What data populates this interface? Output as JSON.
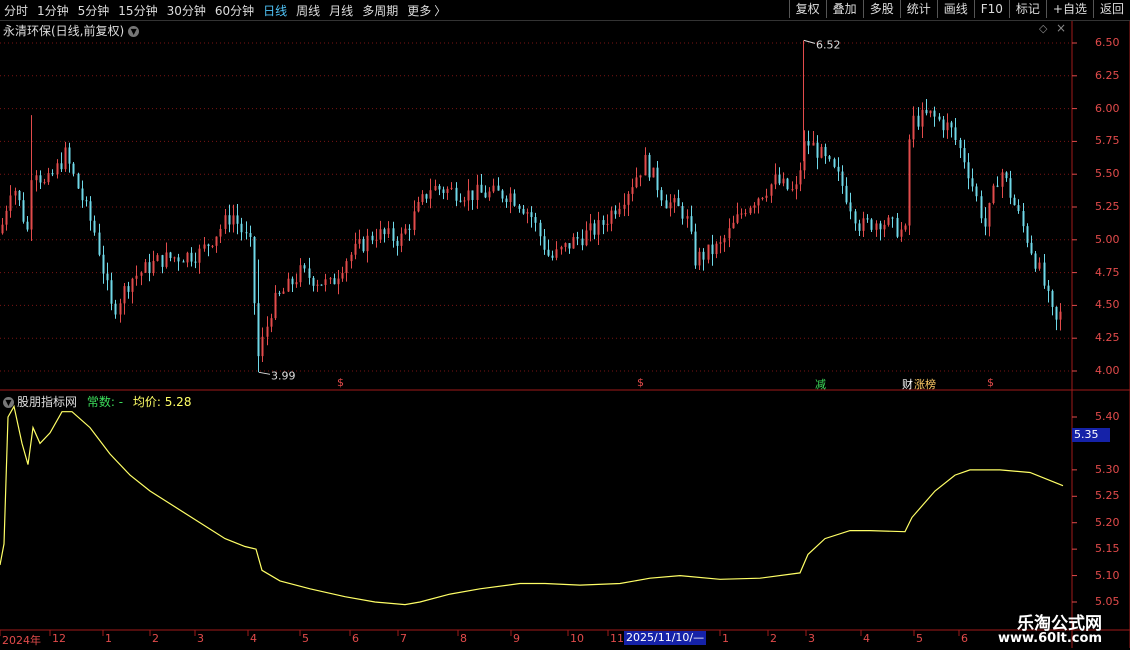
{
  "toolbar": {
    "left_items": [
      "分时",
      "1分钟",
      "5分钟",
      "15分钟",
      "30分钟",
      "60分钟",
      "日线",
      "周线",
      "月线",
      "多周期",
      "更多"
    ],
    "active_item": "日线",
    "more_arrow": "〉",
    "right_items": [
      "复权",
      "叠加",
      "多股",
      "统计",
      "画线",
      "F10",
      "标记",
      "+自选",
      "返回"
    ]
  },
  "main_panel": {
    "title": "永清环保(日线,前复权)",
    "high_label": "6.52",
    "low_label": "3.99",
    "price_axis": [
      "6.50",
      "6.25",
      "6.00",
      "5.75",
      "5.50",
      "5.25",
      "5.00",
      "4.75",
      "4.50",
      "4.25",
      "4.00"
    ],
    "markers": [
      {
        "text": "$",
        "color": "#e24b4b"
      },
      {
        "text": "$",
        "color": "#e24b4b"
      },
      {
        "text": "减",
        "color": "#3cdc5a"
      },
      {
        "text": "财",
        "color": "#ffffff"
      },
      {
        "text": "涨榜",
        "color": "#ffcc66"
      },
      {
        "text": "$",
        "color": "#e24b4b"
      }
    ]
  },
  "sub_panel": {
    "title": "股朋指标网",
    "const_label": "常数: -",
    "avg_label": "均价: 5.28",
    "axis": [
      "5.40",
      "5.30",
      "5.25",
      "5.20",
      "5.15",
      "5.10",
      "5.05"
    ],
    "current_value": "5.35",
    "line_color": "#ffff66"
  },
  "date_axis": {
    "labels": [
      "2024年",
      "12",
      "1",
      "2",
      "3",
      "4",
      "5",
      "6",
      "7",
      "8",
      "9",
      "10",
      "11",
      "1",
      "2",
      "3",
      "4",
      "5",
      "6"
    ],
    "cursor_date": "2025/11/10/—"
  },
  "watermark": {
    "title": "乐淘公式网",
    "url": "www.60lt.com"
  },
  "colors": {
    "up": "#e24b4b",
    "down": "#6fd8e8",
    "grid": "#7a1414",
    "active_tab": "#4fc3f7"
  }
}
